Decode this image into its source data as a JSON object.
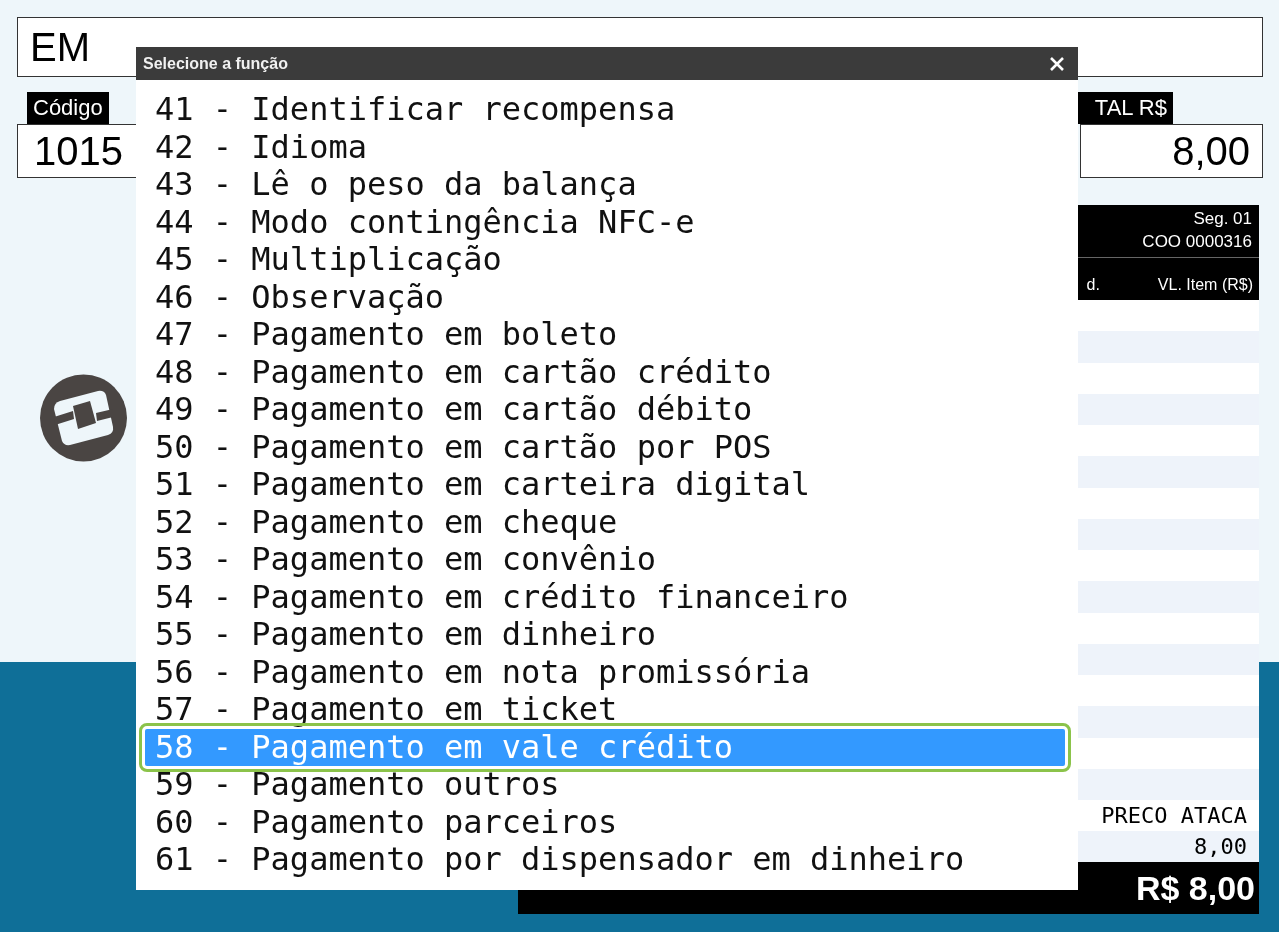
{
  "header": {
    "title": "EM"
  },
  "code": {
    "label": "Código",
    "value": "1015"
  },
  "total": {
    "label": "TAL R$",
    "value": "8,00"
  },
  "receipt": {
    "segment": "Seg. 01",
    "coo": "COO 0000316",
    "columns": [
      "d.",
      "VL. Item (R$)"
    ],
    "item_description": "PRECO ATACA",
    "item_value": "8,00",
    "subtotal_value": "R$ 8,00"
  },
  "dialog": {
    "title": "Selecione a função",
    "items": [
      {
        "label": "41 - Identificar recompensa",
        "selected": false
      },
      {
        "label": "42 - Idioma",
        "selected": false
      },
      {
        "label": "43 - Lê o peso da balança",
        "selected": false
      },
      {
        "label": "44 - Modo contingência NFC-e",
        "selected": false
      },
      {
        "label": "45 - Multiplicação",
        "selected": false
      },
      {
        "label": "46 - Observação",
        "selected": false
      },
      {
        "label": "47 - Pagamento em boleto",
        "selected": false
      },
      {
        "label": "48 - Pagamento em cartão crédito",
        "selected": false
      },
      {
        "label": "49 - Pagamento em cartão débito",
        "selected": false
      },
      {
        "label": "50 - Pagamento em cartão por POS",
        "selected": false
      },
      {
        "label": "51 - Pagamento em carteira digital",
        "selected": false
      },
      {
        "label": "52 - Pagamento em cheque",
        "selected": false
      },
      {
        "label": "53 - Pagamento em convênio",
        "selected": false
      },
      {
        "label": "54 - Pagamento em crédito financeiro",
        "selected": false
      },
      {
        "label": "55 - Pagamento em dinheiro",
        "selected": false
      },
      {
        "label": "56 - Pagamento em nota promissória",
        "selected": false
      },
      {
        "label": "57 - Pagamento em ticket",
        "selected": false
      },
      {
        "label": "58 - Pagamento em vale crédito",
        "selected": true
      },
      {
        "label": "59 - Pagamento outros",
        "selected": false
      },
      {
        "label": "60 - Pagamento parceiros",
        "selected": false
      },
      {
        "label": "61 - Pagamento por dispensador em dinheiro",
        "selected": false
      }
    ]
  }
}
